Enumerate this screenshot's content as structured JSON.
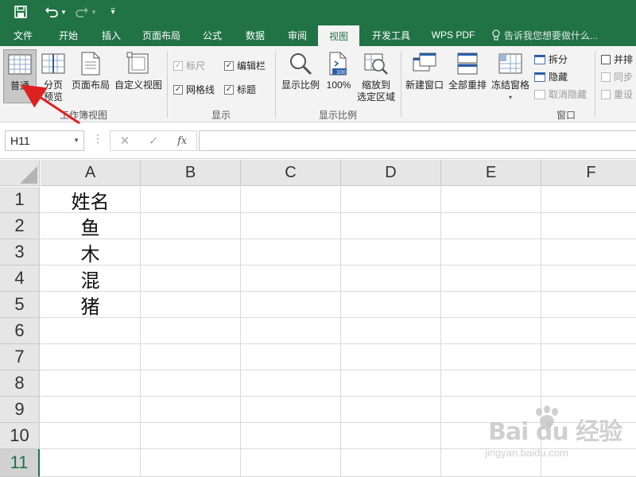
{
  "tabs": [
    "文件",
    "开始",
    "插入",
    "页面布局",
    "公式",
    "数据",
    "审阅",
    "视图",
    "开发工具",
    "WPS PDF"
  ],
  "active_tab": "视图",
  "tell_me": "告诉我您想要做什么...",
  "ribbon": {
    "workbook_views": {
      "normal": "普通",
      "page_break_1": "分页",
      "page_break_2": "预览",
      "page_layout": "页面布局",
      "custom_views": "自定义视图",
      "label": "工作簿视图"
    },
    "show": {
      "ruler": "标尺",
      "formula_bar": "编辑栏",
      "gridlines": "网格线",
      "headings": "标题",
      "label": "显示"
    },
    "zoom": {
      "zoom": "显示比例",
      "hundred": "100%",
      "hundred_icon_text": "100",
      "zoom_to_sel_1": "缩放到",
      "zoom_to_sel_2": "选定区域",
      "label": "显示比例"
    },
    "window": {
      "new_window": "新建窗口",
      "arrange_all": "全部重排",
      "freeze_panes": "冻结窗格",
      "split": "拆分",
      "hide": "隐藏",
      "unhide": "取消隐藏",
      "side_by_side": "并排",
      "sync_scroll": "同步",
      "reset_pos": "重设",
      "label": "窗口"
    }
  },
  "namebox": "H11",
  "columns": [
    "A",
    "B",
    "C",
    "D",
    "E",
    "F"
  ],
  "rows": [
    "1",
    "2",
    "3",
    "4",
    "5",
    "6",
    "7",
    "8",
    "9",
    "10",
    "11"
  ],
  "cells_col_a": [
    "姓名",
    "鱼",
    "木",
    "混",
    "猪",
    "",
    "",
    "",
    "",
    "",
    ""
  ],
  "watermark": {
    "main": "Bai du 经验",
    "sub": "jingyan.baidu.com"
  },
  "colors": {
    "accent": "#217346",
    "arrow": "#e02020"
  }
}
